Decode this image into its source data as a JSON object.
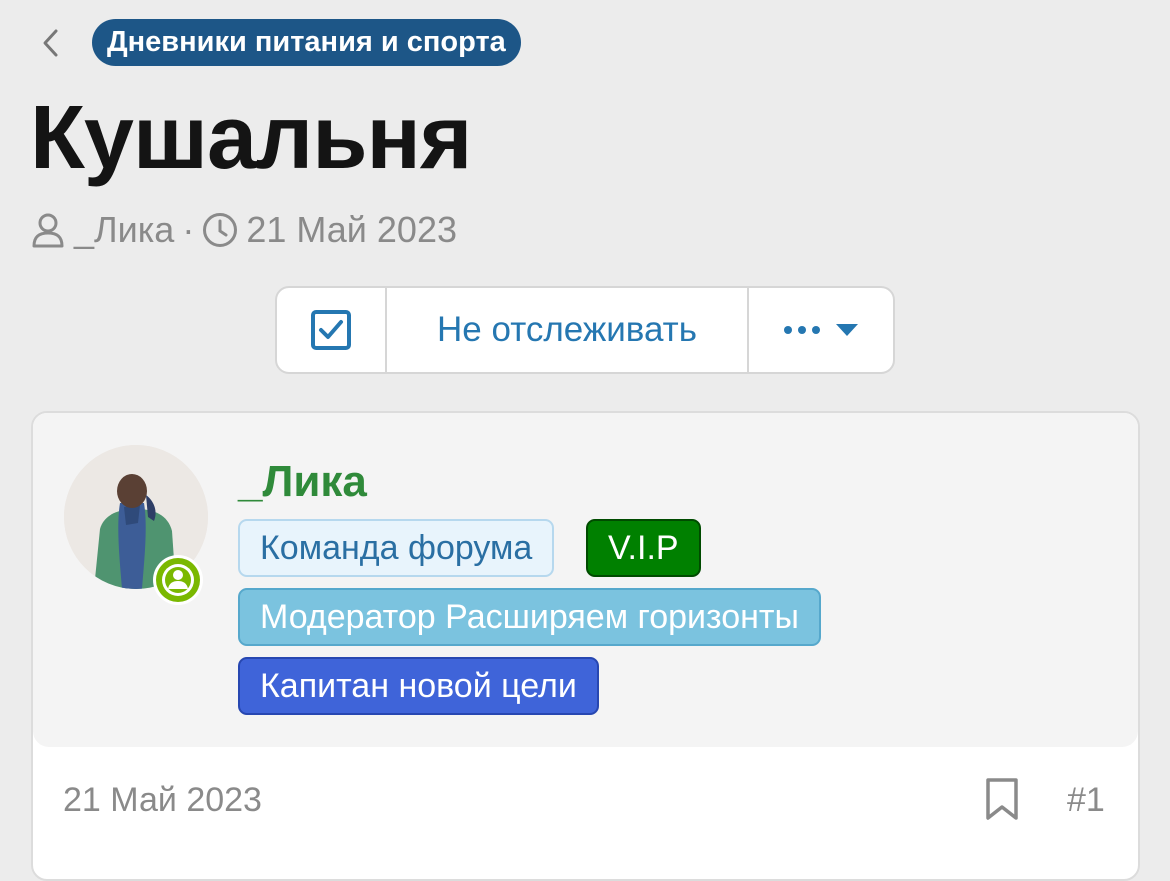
{
  "breadcrumb": {
    "label": "Дневники питания и спорта"
  },
  "thread": {
    "title": "Кушальня",
    "author": "_Лика",
    "separator": "·",
    "date": "21 Май 2023"
  },
  "actions": {
    "watch_label": "Не отслеживать"
  },
  "post": {
    "username": "_Лика",
    "badges": [
      {
        "label": "Команда форума"
      },
      {
        "label": "V.I.P"
      },
      {
        "label": "Модератор Расширяем горизонты"
      },
      {
        "label": "Капитан новой цели"
      }
    ],
    "date": "21 Май 2023",
    "number": "#1",
    "online": true
  },
  "colors": {
    "accent": "#2577b1",
    "breadcrumb_bg": "#1d5687",
    "username": "#2f8a3a",
    "online": "#7ab800"
  },
  "icons": [
    "chevron-left-icon",
    "user-icon",
    "clock-icon",
    "checkbox-checked-icon",
    "ellipsis-icon",
    "caret-down-icon",
    "bookmark-icon"
  ]
}
